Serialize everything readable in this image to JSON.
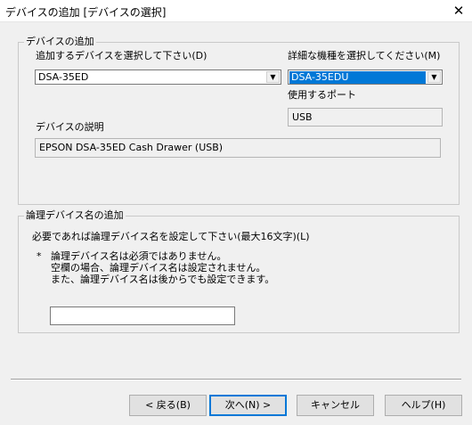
{
  "window": {
    "title": "デバイスの追加 [デバイスの選択]"
  },
  "add_device_group": {
    "title": "デバイスの追加",
    "device_label": "追加するデバイスを選択して下さい(D)",
    "device_value": "DSA-35ED",
    "model_label": "詳細な機種を選択してください(M)",
    "model_value": "DSA-35EDU",
    "port_label": "使用するポート",
    "port_value": "USB",
    "description_label": "デバイスの説明",
    "description_value": "EPSON DSA-35ED Cash Drawer (USB)"
  },
  "logical_name_group": {
    "title": "論理デバイス名の追加",
    "instruction": "必要であれば論理デバイス名を設定して下さい(最大16文字)(L)",
    "note_mark": "*",
    "note_line1": "論理デバイス名は必須ではありません。",
    "note_line2": "空欄の場合、論理デバイス名は設定されません。",
    "note_line3": "また、論理デバイス名は後からでも設定できます。",
    "input_value": ""
  },
  "buttons": {
    "back": "< 戻る(B)",
    "next": "次へ(N) >",
    "cancel": "キャンセル",
    "help": "ヘルプ(H)"
  },
  "colors": {
    "selection": "#0078d7",
    "background": "#f0f0f0"
  }
}
